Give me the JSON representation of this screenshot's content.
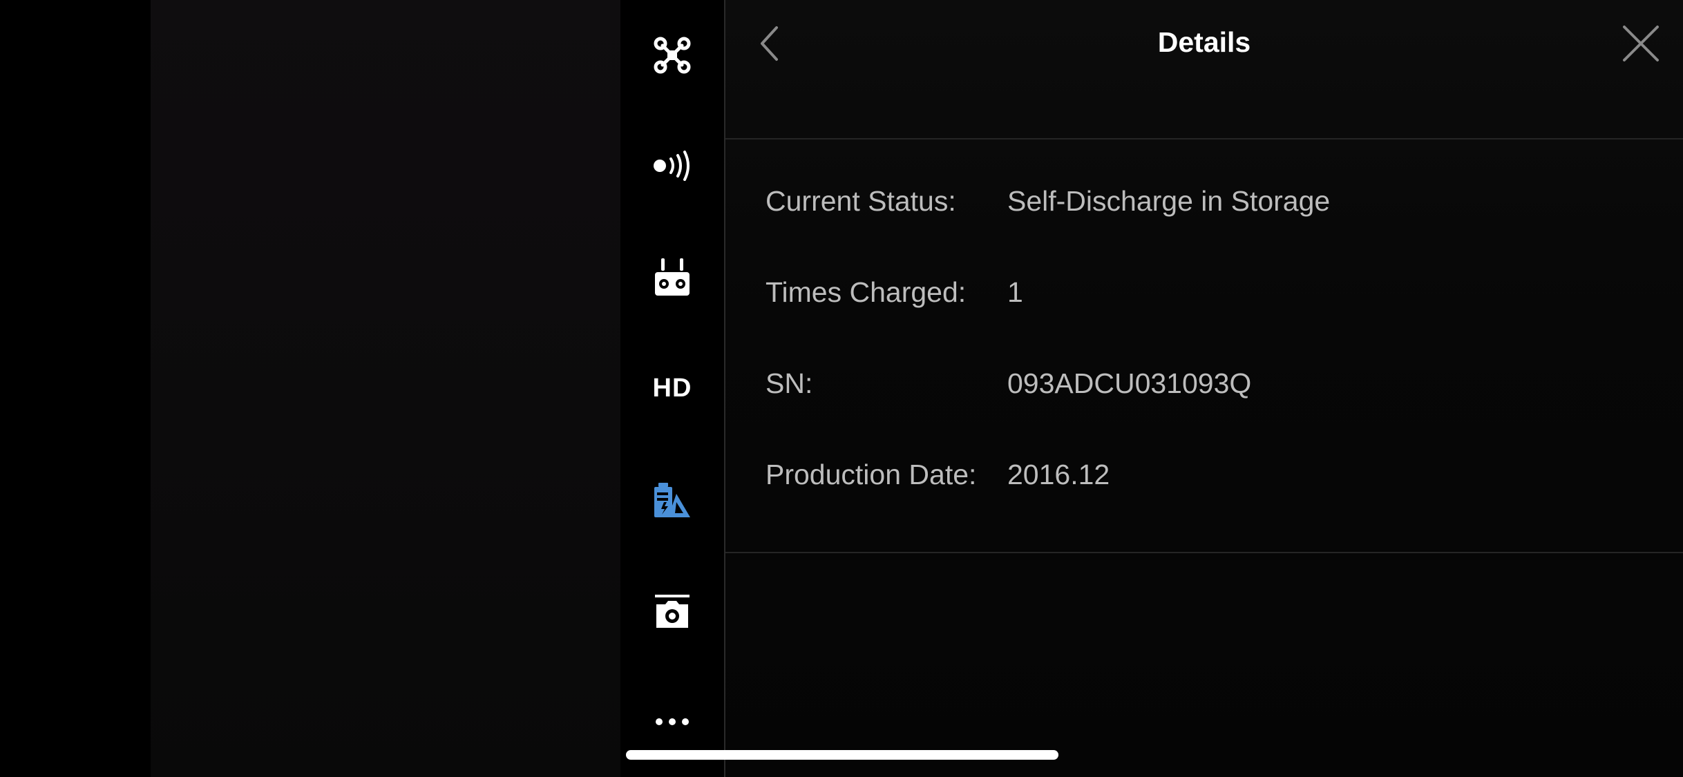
{
  "header": {
    "title": "Details"
  },
  "sidebar": {
    "items": [
      {
        "name": "aircraft",
        "icon": "drone-icon"
      },
      {
        "name": "sensors",
        "icon": "signal-broadcast-icon"
      },
      {
        "name": "remote-controller",
        "icon": "remote-controller-icon"
      },
      {
        "name": "hd",
        "icon": "hd-icon",
        "label": "HD"
      },
      {
        "name": "battery",
        "icon": "battery-detail-icon",
        "active": true
      },
      {
        "name": "camera",
        "icon": "camera-icon"
      },
      {
        "name": "more",
        "icon": "more-dots-icon"
      }
    ]
  },
  "details": {
    "rows": [
      {
        "label": "Current Status:",
        "value": "Self-Discharge in Storage"
      },
      {
        "label": "Times Charged:",
        "value": "1"
      },
      {
        "label": "SN:",
        "value": "093ADCU031093Q"
      },
      {
        "label": "Production Date:",
        "value": "2016.12"
      }
    ]
  },
  "colors": {
    "accent": "#4a90d9",
    "text_primary": "#ffffff",
    "text_secondary": "#bdbdbd",
    "divider": "#2a2a2a"
  }
}
